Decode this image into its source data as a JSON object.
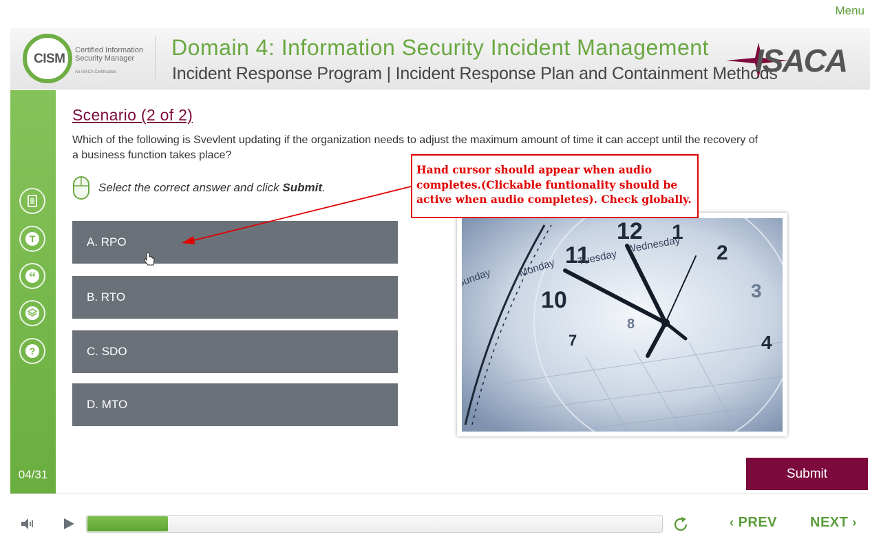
{
  "menu_label": "Menu",
  "header": {
    "logo_text": "CISM",
    "logo_sub_line1": "Certified Information",
    "logo_sub_line2": "Security Manager",
    "logo_sub_small": "An ISACA Certification",
    "title": "Domain 4: Information Security Incident Management",
    "subtitle": "Incident Response Program | Incident Response Plan and Containment Methods",
    "brand": "ISACA"
  },
  "sidebar": {
    "buttons": [
      {
        "name": "notes-icon"
      },
      {
        "name": "transcript-icon"
      },
      {
        "name": "quote-icon"
      },
      {
        "name": "resources-icon"
      },
      {
        "name": "help-icon"
      }
    ],
    "counter": "04/31"
  },
  "main": {
    "title": "Scenario (2 of 2)",
    "question": "Which of the following is Svevlent updating if the organization needs to adjust the maximum amount of time it can accept until the recovery of a business function takes place?",
    "instruction_prefix": "Select the correct answer and click ",
    "instruction_bold": "Submit",
    "instruction_suffix": ".",
    "options": [
      {
        "label": "A. RPO"
      },
      {
        "label": "B. RTO"
      },
      {
        "label": "C. SDO"
      },
      {
        "label": "D. MTO"
      }
    ],
    "submit_label": "Submit"
  },
  "callout": {
    "text": "Hand cursor should appear when audio completes.(Clickable funtionality should be active when audio completes). Check globally."
  },
  "clock_numbers": [
    "12",
    "1",
    "2",
    "3",
    "4",
    "7",
    "8",
    "10",
    "11"
  ],
  "calendar_words": [
    "Monday",
    "Tuesday",
    "Wednesday",
    "Sunday"
  ],
  "footer": {
    "progress": 0.14,
    "prev_label": "PREV",
    "next_label": "NEXT"
  },
  "colors": {
    "accent_green": "#6aa842",
    "burgundy": "#7d0a3c",
    "option_gray": "#6b7178",
    "annotation_red": "#e00000"
  }
}
